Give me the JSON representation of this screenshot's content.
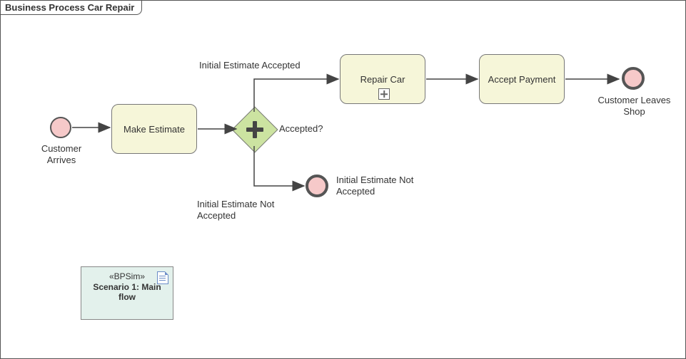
{
  "pool": {
    "title": "Business Process Car Repair"
  },
  "events": {
    "start": {
      "label": "Customer Arrives"
    },
    "end_accepted": {
      "label": "Customer Leaves Shop"
    },
    "end_rejected": {
      "label": "Initial Estimate Not Accepted"
    }
  },
  "tasks": {
    "make_estimate": {
      "label": "Make Estimate"
    },
    "repair_car": {
      "label": "Repair Car"
    },
    "accept_payment": {
      "label": "Accept Payment"
    }
  },
  "gateway": {
    "label": "Accepted?"
  },
  "flows": {
    "accepted_label": "Initial Estimate Accepted",
    "rejected_label": "Initial Estimate Not Accepted"
  },
  "note": {
    "stereotype": "«BPSim»",
    "title": "Scenario 1: Main flow"
  },
  "chart_data": {
    "type": "bpmn-process",
    "name": "Business Process Car Repair",
    "nodes": [
      {
        "id": "start",
        "type": "startEvent",
        "label": "Customer Arrives"
      },
      {
        "id": "est",
        "type": "task",
        "label": "Make Estimate"
      },
      {
        "id": "gw",
        "type": "exclusiveGateway",
        "label": "Accepted?"
      },
      {
        "id": "repair",
        "type": "subProcess",
        "label": "Repair Car"
      },
      {
        "id": "pay",
        "type": "task",
        "label": "Accept Payment"
      },
      {
        "id": "endOk",
        "type": "endEvent",
        "label": "Customer Leaves Shop"
      },
      {
        "id": "endNo",
        "type": "endEvent",
        "label": "Initial Estimate Not Accepted"
      }
    ],
    "flows": [
      {
        "from": "start",
        "to": "est"
      },
      {
        "from": "est",
        "to": "gw"
      },
      {
        "from": "gw",
        "to": "repair",
        "label": "Initial Estimate Accepted"
      },
      {
        "from": "gw",
        "to": "endNo",
        "label": "Initial Estimate Not Accepted"
      },
      {
        "from": "repair",
        "to": "pay"
      },
      {
        "from": "pay",
        "to": "endOk"
      }
    ],
    "artifacts": [
      {
        "type": "bpsim-scenario",
        "label": "Scenario 1: Main flow"
      }
    ]
  }
}
